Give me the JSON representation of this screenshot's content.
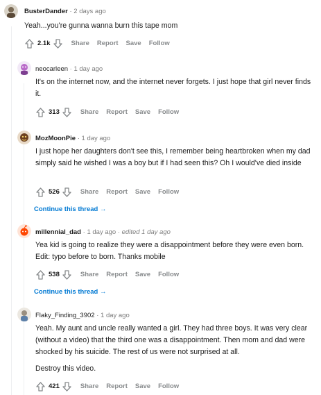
{
  "comments": [
    {
      "user": "BusterDander",
      "time": "2 days ago",
      "edited": "",
      "body": [
        "Yeah...you're gunna wanna burn this tape mom"
      ],
      "score": "2.1k",
      "actions": [
        "Share",
        "Report",
        "Save",
        "Follow"
      ],
      "avatar_color": "#7a6a55"
    },
    {
      "user": "neocarleen",
      "time": "1 day ago",
      "edited": "",
      "body": [
        "It's on the internet now, and the internet never forgets. I just hope that girl never finds it."
      ],
      "score": "313",
      "actions": [
        "Share",
        "Report",
        "Save",
        "Follow"
      ],
      "avatar_color": "#b96ac9"
    },
    {
      "user": "MozMoonPie",
      "time": "1 day ago",
      "edited": "",
      "body": [
        "I just hope her daughters don't see this, I remember being heartbroken when my dad simply said he wished I was a boy but if I had seen this? Oh I would've died inside"
      ],
      "score": "526",
      "actions": [
        "Share",
        "Report",
        "Save",
        "Follow"
      ],
      "avatar_color": "#6b3f1e"
    },
    {
      "user": "millennial_dad",
      "time": "1 day ago",
      "edited": "edited 1 day ago",
      "body": [
        "Yea kid is going to realize they were a disappointment before they were even born. Edit: typo before to born. Thanks mobile"
      ],
      "score": "538",
      "actions": [
        "Share",
        "Report",
        "Save",
        "Follow"
      ],
      "avatar_color": "#ff4500"
    },
    {
      "user": "Flaky_Finding_3902",
      "time": "1 day ago",
      "edited": "",
      "body": [
        "Yeah. My aunt and uncle really wanted a girl. They had three boys. It was very clear (without a video) that the third one was a disappointment. Then mom and dad were shocked by his suicide. The rest of us were not surprised at all.",
        "Destroy this video."
      ],
      "score": "421",
      "actions": [
        "Share",
        "Report",
        "Save",
        "Follow"
      ],
      "avatar_color": "#9a8f80"
    }
  ],
  "continue_thread_label": "Continue this thread",
  "continue_arrow": "→",
  "separator": "·",
  "colors": {
    "link": "#0079d3",
    "meta": "#7c7c7c",
    "action": "#878a8c",
    "text": "#1c1c1c"
  }
}
